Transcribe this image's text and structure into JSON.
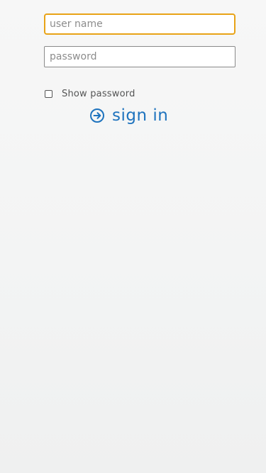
{
  "login": {
    "username": {
      "value": "",
      "placeholder": "user name"
    },
    "password": {
      "value": "",
      "placeholder": "password"
    },
    "show_password": {
      "label": "Show password",
      "checked": false
    },
    "sign_in": {
      "label": "sign in",
      "icon": "arrow-circle-right-icon"
    }
  },
  "colors": {
    "accent": "#1e73be",
    "focus_border": "#e8a317",
    "field_border": "#8a8a8a",
    "background": "#f5f5f5"
  }
}
